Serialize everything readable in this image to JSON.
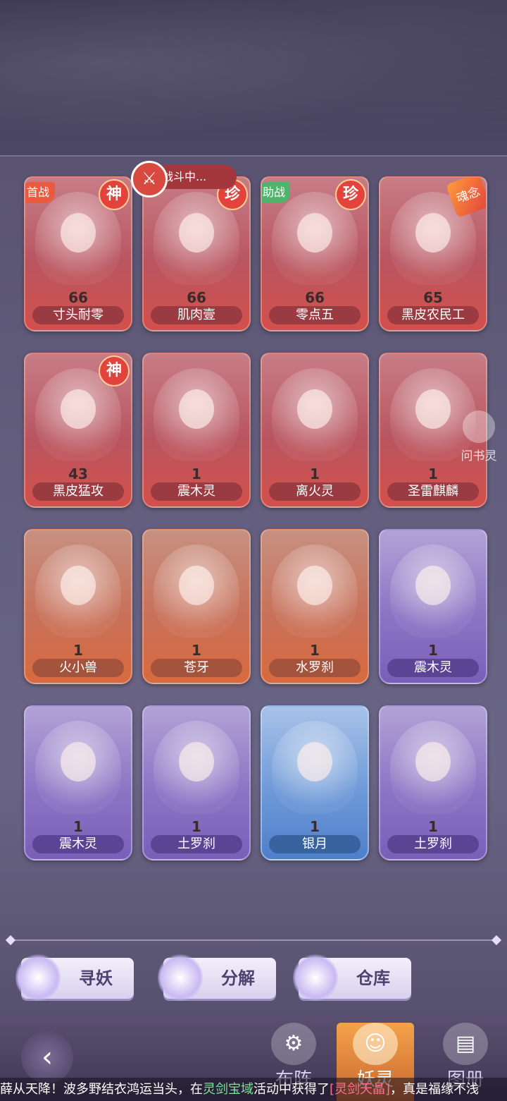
{
  "cards": [
    {
      "name": "寸头耐零",
      "level": "66",
      "theme": "red",
      "badge": "神",
      "tag": "首战"
    },
    {
      "name": "肌肉壹",
      "level": "66",
      "theme": "red",
      "badge": "珍",
      "tag": ""
    },
    {
      "name": "零点五",
      "level": "66",
      "theme": "red",
      "badge": "珍",
      "tag": "助战"
    },
    {
      "name": "黑皮农民工",
      "level": "65",
      "theme": "red",
      "badge": "",
      "tag": "",
      "soul": "魂念"
    },
    {
      "name": "黑皮猛攻",
      "level": "43",
      "theme": "red",
      "badge": "神",
      "tag": ""
    },
    {
      "name": "震木灵",
      "level": "1",
      "theme": "red",
      "badge": "",
      "tag": ""
    },
    {
      "name": "离火灵",
      "level": "1",
      "theme": "red",
      "badge": "",
      "tag": ""
    },
    {
      "name": "圣雷麒麟",
      "level": "1",
      "theme": "red",
      "badge": "",
      "tag": ""
    },
    {
      "name": "火小兽",
      "level": "1",
      "theme": "orange",
      "badge": "",
      "tag": ""
    },
    {
      "name": "苍牙",
      "level": "1",
      "theme": "orange",
      "badge": "",
      "tag": ""
    },
    {
      "name": "水罗刹",
      "level": "1",
      "theme": "orange",
      "badge": "",
      "tag": ""
    },
    {
      "name": "震木灵",
      "level": "1",
      "theme": "purple",
      "badge": "",
      "tag": ""
    },
    {
      "name": "震木灵",
      "level": "1",
      "theme": "purple",
      "badge": "",
      "tag": ""
    },
    {
      "name": "土罗刹",
      "level": "1",
      "theme": "purple",
      "badge": "",
      "tag": ""
    },
    {
      "name": "银月",
      "level": "1",
      "theme": "blue",
      "badge": "",
      "tag": ""
    },
    {
      "name": "土罗刹",
      "level": "1",
      "theme": "purple",
      "badge": "",
      "tag": ""
    }
  ],
  "fight_status": "战斗中...",
  "helper_label": "问书灵",
  "actions": {
    "search": "寻妖",
    "decompose": "分解",
    "storage": "仓库"
  },
  "nav": {
    "formation": "布阵",
    "spirit": "妖灵",
    "album": "图册"
  },
  "ticker": {
    "p1": "薛从天降！波多野结衣鸿运当头，在",
    "p2": "灵剑宝域",
    "p3": "活动中获得了",
    "p4": "[灵剑天晶]",
    "p5": "，真是福缘不浅"
  },
  "colors": {
    "accent": "#e2433c",
    "nav_active": "#f4a24a"
  }
}
